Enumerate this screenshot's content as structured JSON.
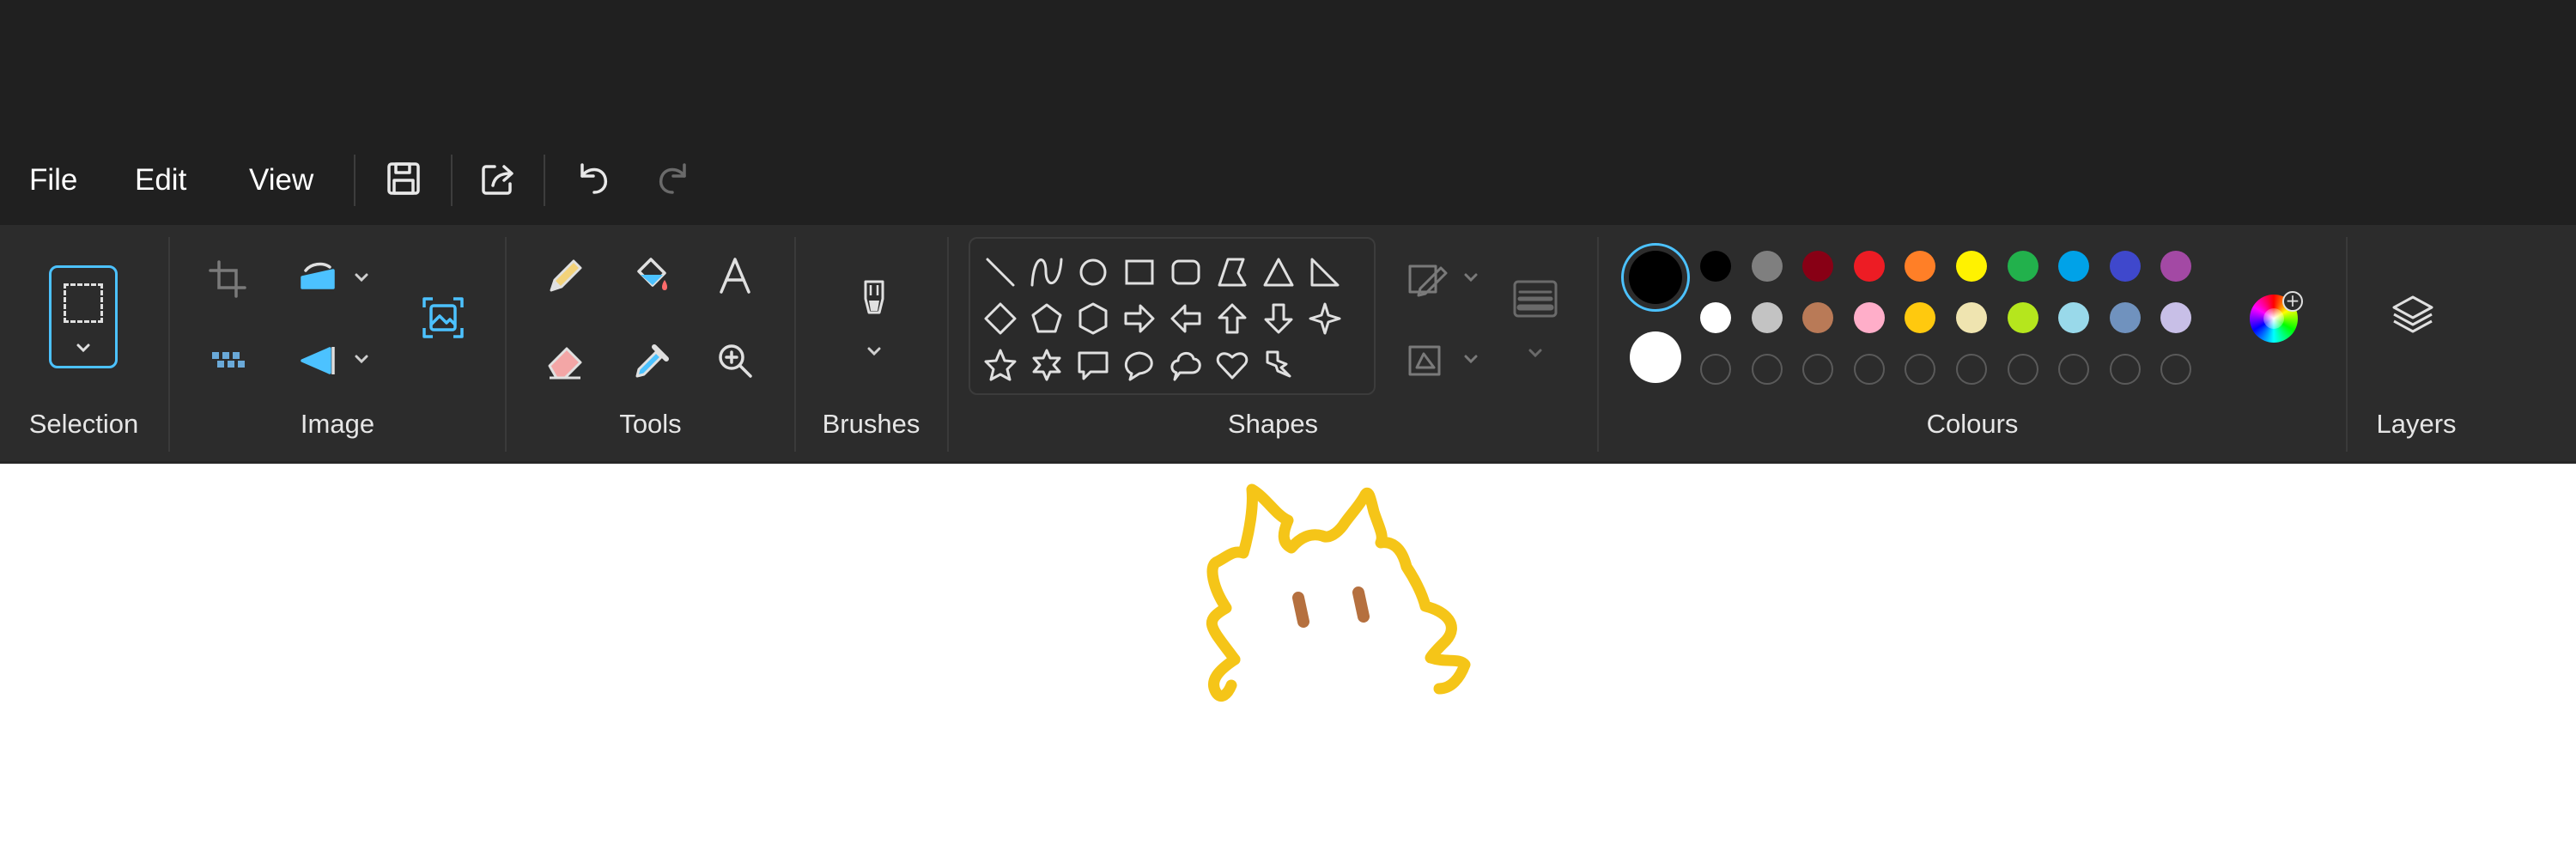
{
  "menu": {
    "file": "File",
    "edit": "Edit",
    "view": "View"
  },
  "groups": {
    "selection": "Selection",
    "image": "Image",
    "tools": "Tools",
    "brushes": "Brushes",
    "shapes": "Shapes",
    "colours": "Colours",
    "layers": "Layers"
  },
  "accent": "#4cc2ff",
  "colours": {
    "primary": "#000000",
    "secondary": "#ffffff",
    "palette_row1": [
      "#000000",
      "#7f7f7f",
      "#880015",
      "#ed1c24",
      "#ff7f27",
      "#fff200",
      "#22b14c",
      "#00a2e8",
      "#3f48cc",
      "#a349a4"
    ],
    "palette_row2": [
      "#ffffff",
      "#c3c3c3",
      "#b97a57",
      "#ffaec9",
      "#ffc90e",
      "#efe4b0",
      "#b5e61d",
      "#99d9ea",
      "#7092be",
      "#c8bfe7"
    ],
    "custom_slots": 10
  },
  "drawing": {
    "stroke_color": "#f5c518",
    "eyes_color": "#b5703f"
  }
}
